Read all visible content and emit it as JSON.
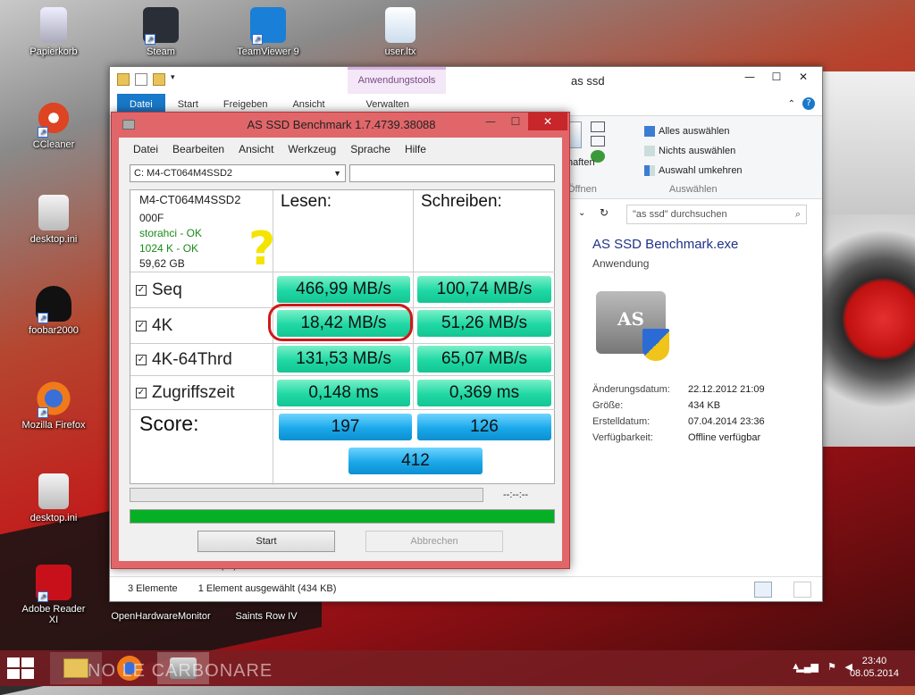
{
  "desktop": {
    "icons": [
      {
        "label": "Papierkorb"
      },
      {
        "label": "Steam"
      },
      {
        "label": "TeamViewer 9"
      },
      {
        "label": "user.ltx"
      },
      {
        "label": "CCleaner"
      },
      {
        "label": "desktop.ini"
      },
      {
        "label": "foobar2000"
      },
      {
        "label": "Mozilla Firefox"
      },
      {
        "label": "desktop.ini"
      },
      {
        "label": "Adobe Reader XI"
      },
      {
        "label": "OpenHardwareMonitor"
      },
      {
        "label": "Saints Row IV"
      }
    ]
  },
  "explorer": {
    "title": "as ssd",
    "contextual_tab": "Anwendungstools",
    "tabs": [
      "Datei",
      "Start",
      "Freigeben",
      "Ansicht",
      "Verwalten"
    ],
    "ribbon": {
      "partial_label": "haften",
      "partial_group": "Öffnen",
      "select_items": [
        "Alles auswählen",
        "Nichts auswählen",
        "Auswahl umkehren"
      ],
      "select_group": "Auswählen"
    },
    "search_placeholder": "\"as ssd\" durchsuchen",
    "preview": {
      "filename": "AS SSD Benchmark.exe",
      "filetype": "Anwendung",
      "icon_text": "AS SSD",
      "properties": [
        {
          "key": "Änderungsdatum:",
          "value": "22.12.2012 21:09"
        },
        {
          "key": "Größe:",
          "value": "434 KB"
        },
        {
          "key": "Erstelldatum:",
          "value": "07.04.2014 23:36"
        },
        {
          "key": "Verfügbarkeit:",
          "value": "Offline verfügbar"
        }
      ]
    },
    "hidden_row": "Win 8 Daten (H:)",
    "status": {
      "count": "3 Elemente",
      "selected": "1 Element ausgewählt (434 KB)"
    }
  },
  "asssd": {
    "title": "AS SSD Benchmark 1.7.4739.38088",
    "menu": [
      "Datei",
      "Bearbeiten",
      "Ansicht",
      "Werkzeug",
      "Sprache",
      "Hilfe"
    ],
    "drive": "C: M4-CT064M4SSD2",
    "device": {
      "model": "M4-CT064M4SSD2",
      "firmware": "000F",
      "driver": "storahci - OK",
      "alignment": "1024 K - OK",
      "size": "59,62 GB"
    },
    "annotation": "?",
    "read_header": "Lesen:",
    "write_header": "Schreiben:",
    "rows": [
      {
        "label": "Seq",
        "checked": true,
        "read": "466,99 MB/s",
        "write": "100,74 MB/s"
      },
      {
        "label": "4K",
        "checked": true,
        "read": "18,42 MB/s",
        "write": "51,26 MB/s"
      },
      {
        "label": "4K-64Thrd",
        "checked": true,
        "read": "131,53 MB/s",
        "write": "65,07 MB/s"
      },
      {
        "label": "Zugriffszeit",
        "checked": true,
        "read": "0,148 ms",
        "write": "0,369 ms"
      }
    ],
    "score_label": "Score:",
    "score_read": "197",
    "score_write": "126",
    "score_total": "412",
    "elapsed": "--:--:--",
    "progress_fraction": 1.0,
    "start_button": "Start",
    "cancel_button": "Abbrechen",
    "checkmark": "✓"
  },
  "taskbar": {
    "watermark": "NO LE CARBONARE",
    "time": "23:40",
    "date": "08.05.2014"
  },
  "colors": {
    "result_green": "#1fd8a4",
    "score_blue": "#1aa8ea",
    "window_frame": "#e06669",
    "highlight_red": "#d01818",
    "progress_green": "#06b025"
  }
}
